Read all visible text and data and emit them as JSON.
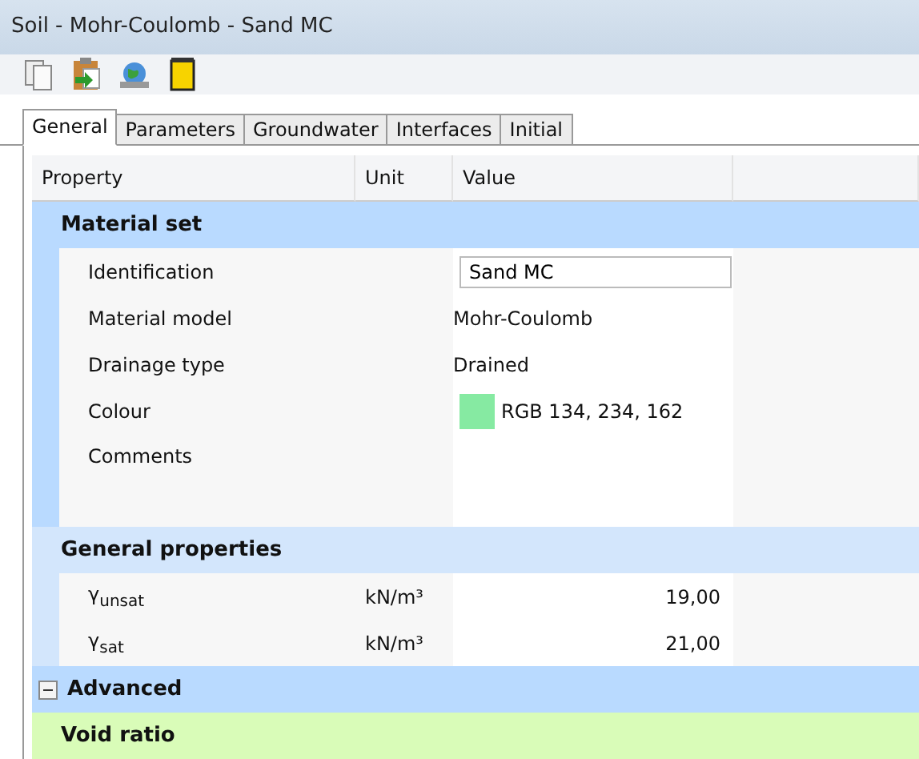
{
  "window": {
    "title": "Soil - Mohr-Coulomb - Sand MC"
  },
  "toolbar": [
    {
      "kind": "copy"
    },
    {
      "kind": "paste"
    },
    {
      "kind": "globe"
    },
    {
      "kind": "cylinder"
    }
  ],
  "tabs": [
    {
      "label": "General",
      "selected": true
    },
    {
      "label": "Parameters",
      "selected": false
    },
    {
      "label": "Groundwater",
      "selected": false
    },
    {
      "label": "Interfaces",
      "selected": false
    },
    {
      "label": "Initial",
      "selected": false
    }
  ],
  "columns": [
    "Property",
    "Unit",
    "Value"
  ],
  "sections": [
    {
      "title": "Material set",
      "color": "#b9daff",
      "rows": [
        {
          "kind": "input",
          "label": "Identification",
          "value": "Sand MC"
        },
        {
          "kind": "text",
          "label": "Material model",
          "value": "Mohr-Coulomb"
        },
        {
          "kind": "text",
          "label": "Drainage type",
          "value": "Drained"
        },
        {
          "kind": "color",
          "label": "Colour",
          "value": "RGB 134, 234, 162",
          "color": "#86eaa2"
        },
        {
          "kind": "multiline",
          "label": "Comments"
        }
      ]
    },
    {
      "title": "General properties",
      "color": "#d3e6fc",
      "rows": [
        {
          "kind": "number",
          "label": "γ$_{unsat}$",
          "unit": "kN/m³",
          "value": "19,00"
        },
        {
          "kind": "number",
          "label": "γ$_{sat}$",
          "unit": "kN/m³",
          "value": "21,00"
        }
      ]
    },
    {
      "title": "Advanced",
      "color": "#b9daff",
      "expanded": true
    },
    {
      "title": "Void ratio",
      "color": "#d9fcb8"
    }
  ]
}
